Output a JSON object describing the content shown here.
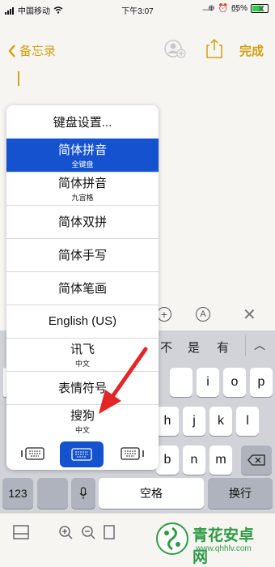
{
  "status": {
    "carrier": "中国移动",
    "time": "下午3:07",
    "battery": "65%"
  },
  "nav": {
    "back_label": "备忘录",
    "done_label": "完成"
  },
  "menu": {
    "items": [
      {
        "label": "键盘设置...",
        "sub": ""
      },
      {
        "label": "简体拼音",
        "sub": "全键盘",
        "selected": true
      },
      {
        "label": "简体拼音",
        "sub": "九宫格"
      },
      {
        "label": "简体双拼",
        "sub": ""
      },
      {
        "label": "简体手写",
        "sub": ""
      },
      {
        "label": "简体笔画",
        "sub": ""
      },
      {
        "label": "English (US)",
        "sub": ""
      },
      {
        "label": "讯飞",
        "sub": "中文"
      },
      {
        "label": "表情符号",
        "sub": ""
      },
      {
        "label": "搜狗",
        "sub": "中文"
      }
    ],
    "selected_color": "#1552d0"
  },
  "keyboard": {
    "candidates": [
      "不",
      "是",
      "有"
    ],
    "row1_tail": [
      "i",
      "o",
      "p"
    ],
    "row2_tail": [
      "h",
      "j",
      "k",
      "l"
    ],
    "row3_tail": [
      "b",
      "n",
      "m"
    ],
    "num_label": "123",
    "space_label": "空格",
    "return_label": "换行"
  },
  "watermark": {
    "title": "青花安卓网",
    "url": "www.qhhlv.com"
  },
  "accent_color": "#d1a012"
}
